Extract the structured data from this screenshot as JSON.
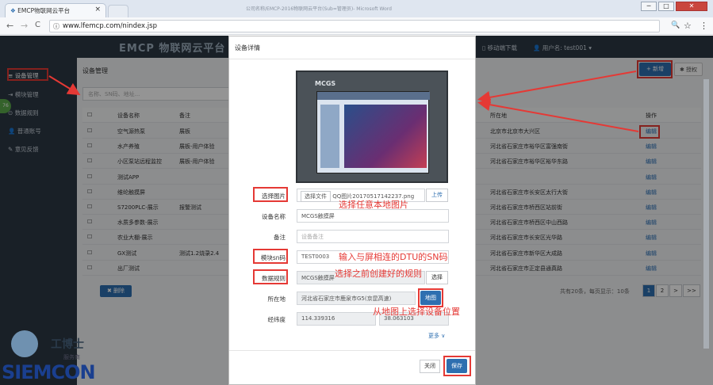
{
  "browser": {
    "tab_title": "EMCP物联网云平台",
    "window_title": "公司名称/EMCP-2016物联网云平台(Sub=管理员)- Microsoft Word",
    "url": "www.lfemcp.com/nindex.jsp",
    "back": "←",
    "forward": "→",
    "reload": "C",
    "close_tab": "×",
    "win_min": "─",
    "win_max": "□",
    "win_close": "✕",
    "search_icon": "🔍",
    "star_icon": "☆",
    "menu_icon": "⋮"
  },
  "header": {
    "logo": "EMCP 物联网云平台",
    "mobile_download": "移动端下载",
    "username": "用户名: test001 ▾"
  },
  "sidebar": {
    "items": [
      {
        "label": "设备管理",
        "icon": "≡"
      },
      {
        "label": "模块管理",
        "icon": "⇥"
      },
      {
        "label": "数据规则",
        "icon": "⊙"
      },
      {
        "label": "普通账号",
        "icon": "👤"
      },
      {
        "label": "意见反馈",
        "icon": "✎"
      }
    ],
    "badge": "76"
  },
  "main": {
    "breadcrumb": "设备管理",
    "search_placeholder": "名称、SN码、地址...",
    "add_button": "+ 新增",
    "auth_button": "✱ 授权",
    "columns": {
      "name": "设备名称",
      "remark": "备注",
      "location": "所在地",
      "action": "操作"
    },
    "rows": [
      {
        "name": "空气源热泵",
        "remark": "展板",
        "location": "北京市北京市大兴区",
        "action": "编辑"
      },
      {
        "name": "水产养殖",
        "remark": "展板-用户体验",
        "location": "河北省石家庄市裕华区富强南街",
        "action": "编辑"
      },
      {
        "name": "小区泵站远程监控",
        "remark": "展板-用户体验",
        "location": "河北省石家庄市裕华区裕华东路",
        "action": "编辑"
      },
      {
        "name": "测试APP",
        "remark": "",
        "location": "",
        "action": "编辑"
      },
      {
        "name": "维纶触摸屏",
        "remark": "",
        "location": "河北省石家庄市长安区太行大街",
        "action": "编辑"
      },
      {
        "name": "S7200PLC-展示",
        "remark": "报警测试",
        "location": "河北省石家庄市桥西区站前街",
        "action": "编辑"
      },
      {
        "name": "水质多参数-展示",
        "remark": "",
        "location": "河北省石家庄市桥西区中山西路",
        "action": "编辑"
      },
      {
        "name": "农业大棚-展示",
        "remark": "",
        "location": "河北省石家庄市长安区光华路",
        "action": "编辑"
      },
      {
        "name": "GX测试",
        "remark": "测试1.2烧录2.4",
        "location": "河北省石家庄市新华区大成路",
        "action": "编辑"
      },
      {
        "name": "出厂测试",
        "remark": "",
        "location": "河北省石家庄市正定县通真路",
        "action": "编辑"
      }
    ],
    "delete_button": "✖ 删除",
    "pagination_info": "共有20条，每页显示：10条",
    "pages": [
      "1",
      "2",
      ">",
      ">>"
    ]
  },
  "modal": {
    "title": "设备详情",
    "screen_brand": "MCGS",
    "fields": {
      "image_label": "选择图片",
      "choose_file": "选择文件",
      "file_name": "QQ图片20170517142237.png",
      "upload": "上传",
      "name_label": "设备名称",
      "name_value": "MCGS触摸屏",
      "remark_label": "备注",
      "remark_placeholder": "设备备注",
      "sn_label": "模块sn码",
      "sn_value": "TEST0003",
      "rule_label": "数据规则",
      "rule_value": "MCGS触摸屏",
      "rule_button": "选择",
      "location_label": "所在地",
      "location_value": "河北省石家庄市鹿泉市G5(京昆高速)",
      "map_button": "地图",
      "lnglat_label": "经纬度",
      "lng_value": "114.339316",
      "lat_value": "38.063103",
      "more": "更多 ∨"
    },
    "close_button": "关闭",
    "save_button": "保存"
  },
  "annotations": {
    "choose_image": "选择任意本地图片",
    "sn": "输入与屏相连的DTU的SN码",
    "rule": "选择之前创建好的规则",
    "map": "从地图上选择设备位置"
  },
  "watermark": {
    "company": "工博士",
    "service": "服务商",
    "brand": "SIEMCON"
  },
  "colors": {
    "header_bg": "#2b3744",
    "accent": "#2e6fb0",
    "annotation": "#e53935"
  }
}
